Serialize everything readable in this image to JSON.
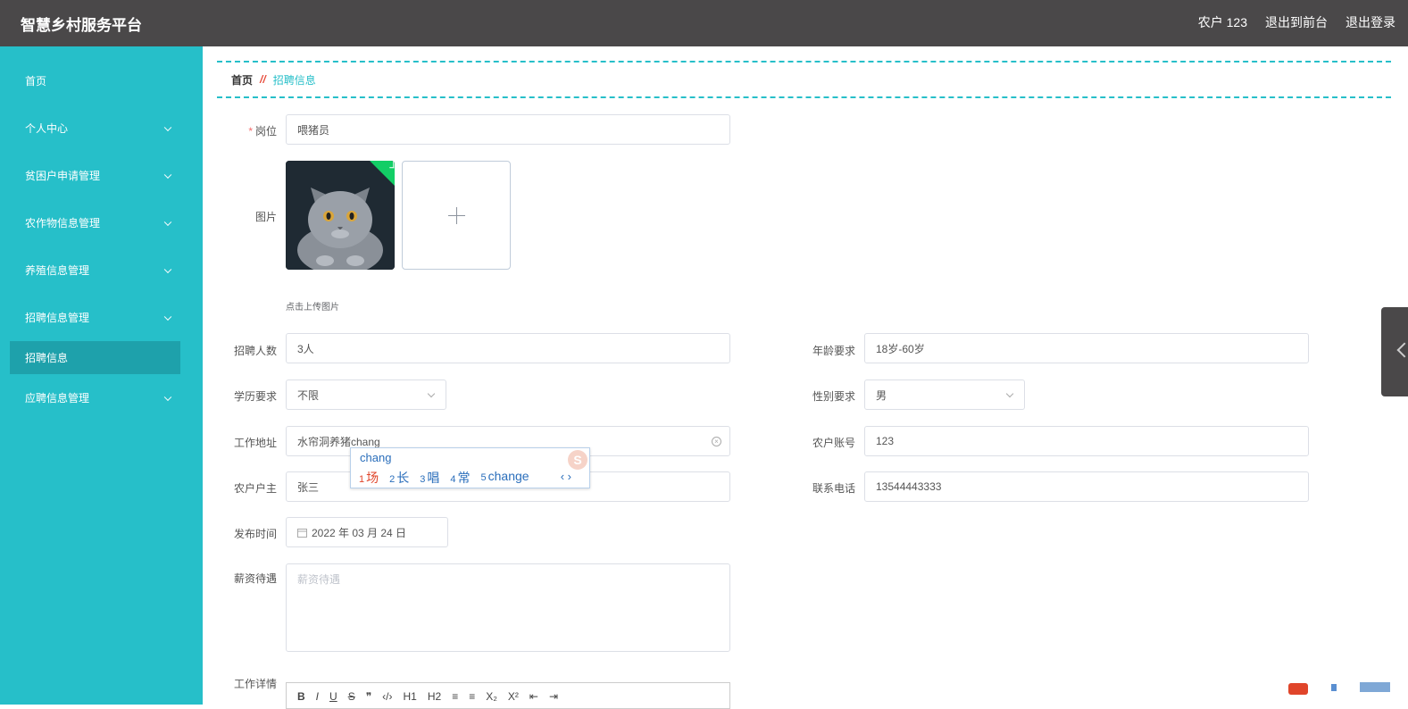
{
  "header": {
    "title": "智慧乡村服务平台",
    "user": "农户 123",
    "to_front": "退出到前台",
    "logout": "退出登录"
  },
  "sidebar": {
    "items": [
      {
        "label": "首页"
      },
      {
        "label": "个人中心"
      },
      {
        "label": "贫困户申请管理"
      },
      {
        "label": "农作物信息管理"
      },
      {
        "label": "养殖信息管理"
      },
      {
        "label": "招聘信息管理"
      },
      {
        "label": "招聘信息"
      },
      {
        "label": "应聘信息管理"
      }
    ]
  },
  "breadcrumb": {
    "home": "首页",
    "sep": "//",
    "current": "招聘信息"
  },
  "form": {
    "position": {
      "label": "岗位",
      "value": "喂猪员"
    },
    "image": {
      "label": "图片",
      "hint": "点击上传图片"
    },
    "headcount": {
      "label": "招聘人数",
      "value": "3人"
    },
    "age": {
      "label": "年龄要求",
      "value": "18岁-60岁"
    },
    "education": {
      "label": "学历要求",
      "value": "不限"
    },
    "gender": {
      "label": "性别要求",
      "value": "男"
    },
    "address": {
      "label": "工作地址",
      "value": "水帘洞养猪chang"
    },
    "account": {
      "label": "农户账号",
      "value": "123"
    },
    "owner": {
      "label": "农户户主",
      "value": "张三"
    },
    "phone": {
      "label": "联系电话",
      "value": "13544443333"
    },
    "date": {
      "label": "发布时间",
      "value": "2022 年 03 月 24 日"
    },
    "salary": {
      "label": "薪资待遇",
      "placeholder": "薪资待遇"
    },
    "details": {
      "label": "工作详情"
    }
  },
  "ime": {
    "typed": "chang",
    "candidates": [
      {
        "n": "1",
        "text": "场"
      },
      {
        "n": "2",
        "text": "长"
      },
      {
        "n": "3",
        "text": "唱"
      },
      {
        "n": "4",
        "text": "常"
      },
      {
        "n": "5",
        "text": "change"
      }
    ],
    "nav": "‹ ›",
    "logo": "S"
  },
  "editor_toolbar": [
    "B",
    "I",
    "U",
    "S",
    "❞",
    "‹/›",
    "H1",
    "H2",
    "≡",
    "≡",
    "X₂",
    "X²",
    "⇤",
    "⇥"
  ],
  "colors": {
    "accent": "#26bfc9",
    "header_bg": "#4a4849",
    "active_item": "#1ea1ab"
  }
}
